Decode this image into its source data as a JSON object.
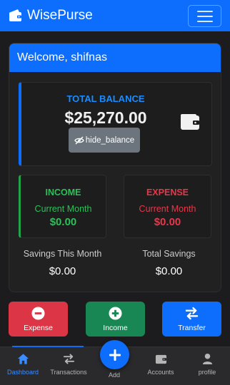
{
  "app": {
    "brand": "WisePurse"
  },
  "card": {
    "welcome": "Welcome, shifnas",
    "total_balance_label": "TOTAL BALANCE",
    "total_balance_value": "$25,270.00",
    "hide_balance_label": "hide_balance"
  },
  "income": {
    "title": "INCOME",
    "period": "Current Month",
    "value": "$0.00",
    "color": "#2fbf5a"
  },
  "expense": {
    "title": "EXPENSE",
    "period": "Current Month",
    "value": "$0.00",
    "color": "#e5384a"
  },
  "savings": {
    "month_label": "Savings This Month",
    "month_value": "$0.00",
    "total_label": "Total Savings",
    "total_value": "$0.00"
  },
  "actions": [
    {
      "label": "Expense",
      "icon": "minus-circle-icon",
      "color": "#dc3545"
    },
    {
      "label": "Income",
      "icon": "plus-circle-icon",
      "color": "#198754"
    },
    {
      "label": "Transfer",
      "icon": "swap-arrows-icon",
      "color": "#0d6efd"
    }
  ],
  "bottom_nav": [
    {
      "label": "Dashboard",
      "icon": "home-icon",
      "active": true
    },
    {
      "label": "Transactions",
      "icon": "swap-arrows-icon",
      "active": false
    },
    {
      "label": "Add",
      "icon": "plus-icon",
      "active": false
    },
    {
      "label": "Accounts",
      "icon": "wallet-icon",
      "active": false
    },
    {
      "label": "profile",
      "icon": "user-icon",
      "active": false
    }
  ],
  "colors": {
    "primary": "#0d6efd",
    "background": "#1c1c1e",
    "card": "#212121"
  }
}
